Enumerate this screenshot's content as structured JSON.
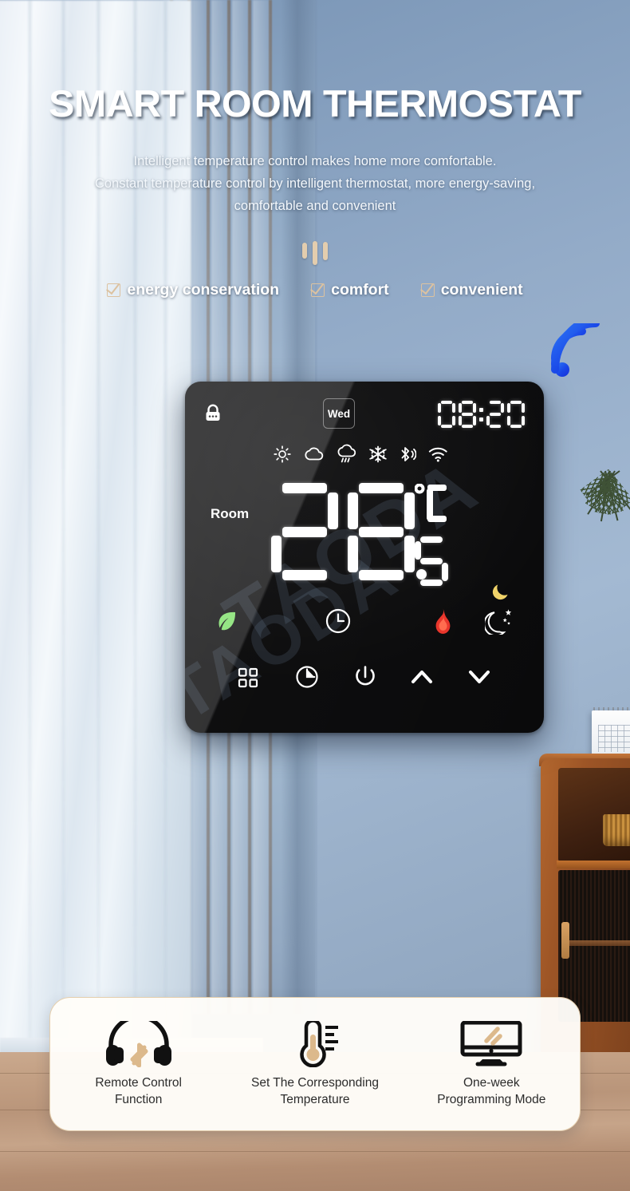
{
  "header": {
    "title": "SMART ROOM THERMOSTAT",
    "subtitle_line1": "Intelligent temperature control makes home more comfortable.",
    "subtitle_line2": "Constant temperature control by intelligent thermostat, more energy-saving,",
    "subtitle_line3": "comfortable and convenient",
    "badges": [
      {
        "label": "energy conservation",
        "icon": "checkbox-checked-icon"
      },
      {
        "label": "comfort",
        "icon": "checkbox-checked-icon"
      },
      {
        "label": "convenient",
        "icon": "checkbox-checked-icon"
      }
    ],
    "decor_icon": "wifi-signal-icon",
    "accent_tan": "#dcc2a0",
    "wifi_blue": "#1a4fe0"
  },
  "device": {
    "lock_icon": "lock-icon",
    "day": "Wed",
    "time": "08:20",
    "room_label": "Room",
    "temperature": "28.5",
    "temperature_integer": "28",
    "temperature_decimal": "5",
    "unit": "°C",
    "watermark": "TAODA",
    "status_icons": [
      "sun-icon",
      "cloud-icon",
      "rain-cloud-icon",
      "snowflake-icon",
      "bluetooth-broadcast-icon",
      "wifi-icon"
    ],
    "indicator_icons": [
      "leaf-eco-icon",
      "clock-icon",
      "flame-heating-icon",
      "moon-stars-night-icon"
    ],
    "moon_badge_icon": "moon-crescent-icon",
    "control_buttons": [
      "grid-menu-icon",
      "timer-icon",
      "power-icon",
      "chevron-up-icon",
      "chevron-down-icon"
    ],
    "screen_color": "#0a0a0b",
    "flame_color": "#e8342a",
    "leaf_color": "#7ee06a",
    "moon_color": "#f0d368"
  },
  "features": [
    {
      "icon": "bluetooth-headphones-icon",
      "label_line1": "Remote Control",
      "label_line2": "Function"
    },
    {
      "icon": "thermometer-icon",
      "label_line1": "Set The Corresponding",
      "label_line2": "Temperature"
    },
    {
      "icon": "monitor-screen-icon",
      "label_line1": "One-week",
      "label_line2": "Programming Mode"
    }
  ]
}
